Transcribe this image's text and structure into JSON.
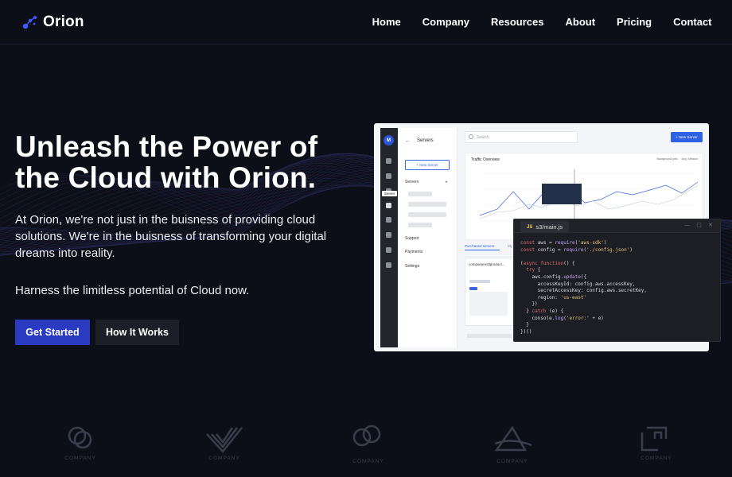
{
  "nav": {
    "brand": "Orion",
    "links": [
      "Home",
      "Company",
      "Resources",
      "About",
      "Pricing",
      "Contact"
    ]
  },
  "hero": {
    "title_line1": "Unleash the Power of",
    "title_line2": "the Cloud with Orion.",
    "description": "At Orion, we're not just in the buisness of providing cloud solutions. We're in the buisness of transforming your digital dreams into reality.",
    "subtext": "Harness the limitless potential of Cloud now.",
    "primary_button": "Get Started",
    "secondary_button": "How It Works"
  },
  "mock_app": {
    "avatar": "M",
    "tooltip": "Server",
    "sidebar_title": "Servers",
    "new_server_sidebar": "New Server",
    "sections": [
      "Servers",
      "Support",
      "Payments",
      "Settings"
    ],
    "search_placeholder": "Search",
    "new_server_button": "New Server",
    "chart_title": "Traffic Overview",
    "chart_legend": [
      "Background jobs",
      "Avg. Session"
    ],
    "tab_active": "Purchased servers",
    "tab_other": "My",
    "card_title": "companyrestlproduct..."
  },
  "code_window": {
    "filename": "s3/main.js",
    "badge": "JS",
    "controls": "— ▢ ✕",
    "lines": [
      [
        {
          "t": "const ",
          "c": "kw"
        },
        {
          "t": "aws = "
        },
        {
          "t": "require",
          "c": "fn"
        },
        {
          "t": "("
        },
        {
          "t": "'aws-sdk'",
          "c": "str"
        },
        {
          "t": ")"
        }
      ],
      [
        {
          "t": "const ",
          "c": "kw"
        },
        {
          "t": "config = "
        },
        {
          "t": "require",
          "c": "fn"
        },
        {
          "t": "("
        },
        {
          "t": "'./config.json'",
          "c": "str"
        },
        {
          "t": ")"
        }
      ],
      [
        {
          "t": ""
        }
      ],
      [
        {
          "t": "("
        },
        {
          "t": "async function",
          "c": "kw"
        },
        {
          "t": "() {"
        }
      ],
      [
        {
          "t": "  "
        },
        {
          "t": "try",
          "c": "kw"
        },
        {
          "t": " {"
        }
      ],
      [
        {
          "t": "    aws.config."
        },
        {
          "t": "update",
          "c": "fn"
        },
        {
          "t": "({"
        }
      ],
      [
        {
          "t": "      accessKeyId: config.aws.accessKey,"
        }
      ],
      [
        {
          "t": "      secretAccessKey: config.aws.secretKey,"
        }
      ],
      [
        {
          "t": "      region: "
        },
        {
          "t": "'us-east'",
          "c": "str"
        }
      ],
      [
        {
          "t": "    })"
        }
      ],
      [
        {
          "t": "  } "
        },
        {
          "t": "catch",
          "c": "kw"
        },
        {
          "t": " (e) {"
        }
      ],
      [
        {
          "t": "    console."
        },
        {
          "t": "log",
          "c": "fn"
        },
        {
          "t": "("
        },
        {
          "t": "'error:'",
          "c": "str"
        },
        {
          "t": " + e)"
        }
      ],
      [
        {
          "t": "  }"
        }
      ],
      [
        {
          "t": "})()"
        }
      ]
    ]
  },
  "partner_logos": [
    {
      "icon": "circles-logo-icon",
      "label": "COMPANY"
    },
    {
      "icon": "stripes-logo-icon",
      "label": "COMPANY"
    },
    {
      "icon": "rings-logo-icon",
      "label": "COMPANY"
    },
    {
      "icon": "arrow-logo-icon",
      "label": "COMPANY"
    },
    {
      "icon": "squares-logo-icon",
      "label": "COMPANY"
    }
  ],
  "colors": {
    "background": "#0d0f18",
    "primary_button": "#2a3bc2",
    "secondary_button": "#1d1f28",
    "accent_blue": "#2e62e3"
  }
}
